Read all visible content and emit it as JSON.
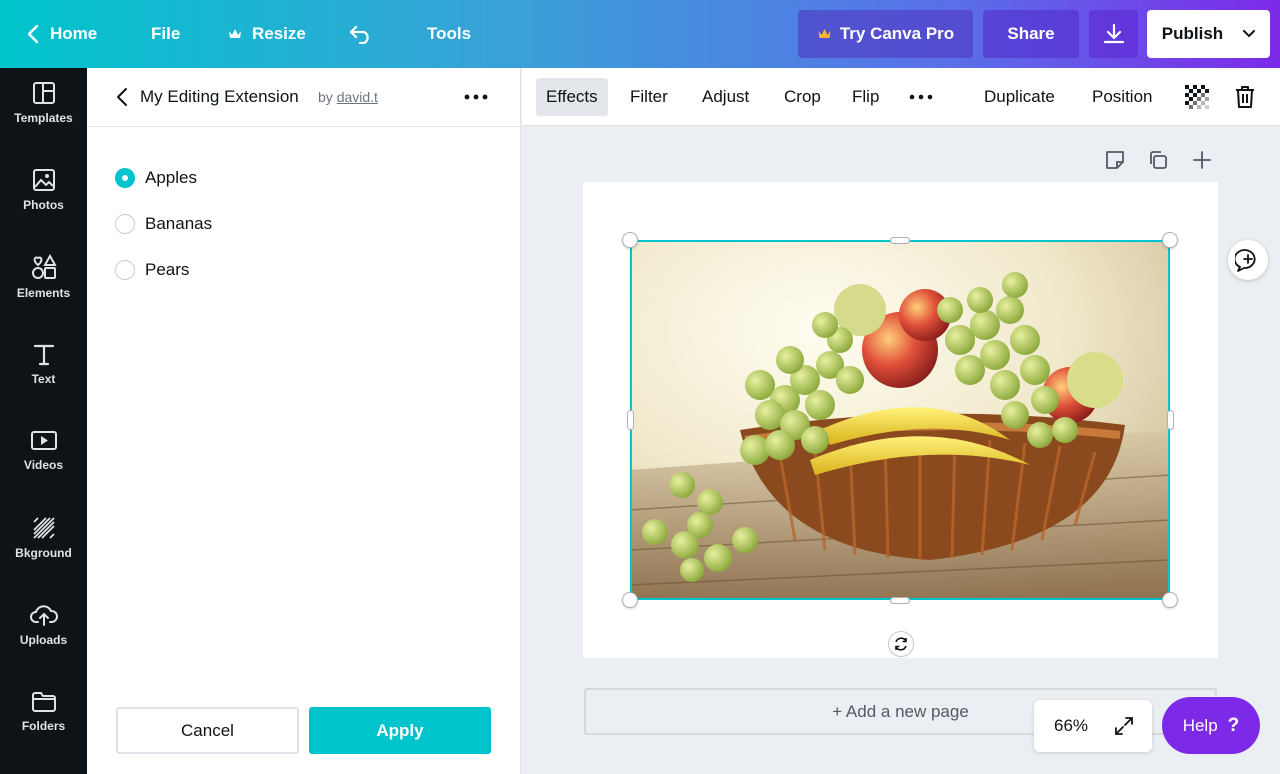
{
  "topbar": {
    "home": "Home",
    "file": "File",
    "resize": "Resize",
    "tools": "Tools",
    "try_pro": "Try Canva Pro",
    "share": "Share",
    "publish": "Publish"
  },
  "sidebar": {
    "items": [
      {
        "label": "Templates",
        "icon": "templates-icon"
      },
      {
        "label": "Photos",
        "icon": "photos-icon"
      },
      {
        "label": "Elements",
        "icon": "elements-icon"
      },
      {
        "label": "Text",
        "icon": "text-icon"
      },
      {
        "label": "Videos",
        "icon": "videos-icon"
      },
      {
        "label": "Bkground",
        "icon": "background-icon"
      },
      {
        "label": "Uploads",
        "icon": "uploads-icon"
      },
      {
        "label": "Folders",
        "icon": "folders-icon"
      }
    ]
  },
  "panel": {
    "title": "My Editing Extension",
    "by": "by",
    "author": "david.t",
    "options": [
      {
        "label": "Apples",
        "selected": true
      },
      {
        "label": "Bananas",
        "selected": false
      },
      {
        "label": "Pears",
        "selected": false
      }
    ],
    "cancel": "Cancel",
    "apply": "Apply"
  },
  "toolbar": {
    "effects": "Effects",
    "filter": "Filter",
    "adjust": "Adjust",
    "crop": "Crop",
    "flip": "Flip",
    "duplicate": "Duplicate",
    "position": "Position"
  },
  "canvas": {
    "add_page": "+ Add a new page",
    "zoom": "66%",
    "help": "Help",
    "help_mark": "?"
  },
  "colors": {
    "accent": "#00c4cc",
    "purple": "#7d2ae8",
    "sidebar_bg": "#0e1318"
  }
}
